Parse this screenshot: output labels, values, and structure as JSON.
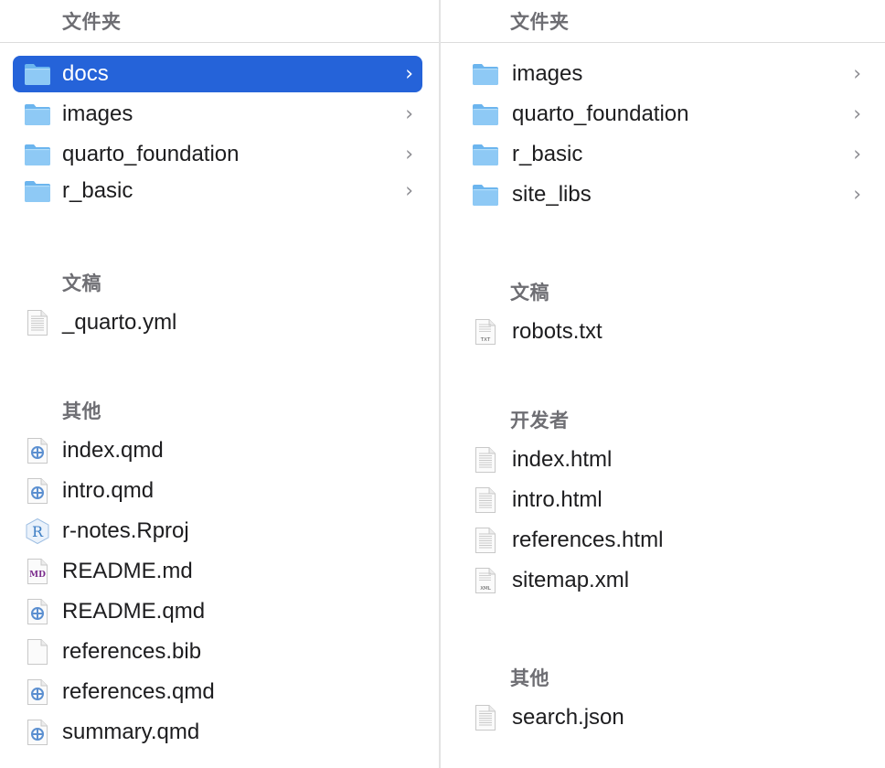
{
  "left_column": {
    "folders_title": "文件夹",
    "folders": [
      {
        "label": "docs",
        "selected": true
      },
      {
        "label": "images"
      },
      {
        "label": "quarto_foundation"
      },
      {
        "label": "r_basic"
      }
    ],
    "documents_title": "文稿",
    "documents": [
      {
        "label": "_quarto.yml",
        "icon": "generic-document-icon"
      }
    ],
    "other_title": "其他",
    "other": [
      {
        "label": "index.qmd",
        "icon": "quarto-file-icon"
      },
      {
        "label": "intro.qmd",
        "icon": "quarto-file-icon"
      },
      {
        "label": "r-notes.Rproj",
        "icon": "rproj-file-icon",
        "icon_text": "R"
      },
      {
        "label": "README.md",
        "icon": "markdown-file-icon",
        "icon_text": "MD"
      },
      {
        "label": "README.qmd",
        "icon": "quarto-file-icon"
      },
      {
        "label": "references.bib",
        "icon": "blank-document-icon"
      },
      {
        "label": "references.qmd",
        "icon": "quarto-file-icon"
      },
      {
        "label": "summary.qmd",
        "icon": "quarto-file-icon"
      }
    ]
  },
  "right_column": {
    "folders_title": "文件夹",
    "folders": [
      {
        "label": "images"
      },
      {
        "label": "quarto_foundation"
      },
      {
        "label": "r_basic"
      },
      {
        "label": "site_libs"
      }
    ],
    "documents_title": "文稿",
    "documents": [
      {
        "label": "robots.txt",
        "icon": "txt-file-icon",
        "icon_text": "TXT"
      }
    ],
    "developer_title": "开发者",
    "developer": [
      {
        "label": "index.html",
        "icon": "html-file-icon"
      },
      {
        "label": "intro.html",
        "icon": "html-file-icon"
      },
      {
        "label": "references.html",
        "icon": "html-file-icon"
      },
      {
        "label": "sitemap.xml",
        "icon": "xml-file-icon",
        "icon_text": "XML"
      }
    ],
    "other_title": "其他",
    "other": [
      {
        "label": "search.json",
        "icon": "json-file-icon"
      }
    ]
  },
  "chevron_glyph": "›",
  "colors": {
    "selection": "#2563d9",
    "folder": "#6cb5ee",
    "section_title": "#6e6e73",
    "quarto": "#5b8fd0",
    "rproj": "#3d7ec4",
    "markdown": "#7a2b8c"
  }
}
